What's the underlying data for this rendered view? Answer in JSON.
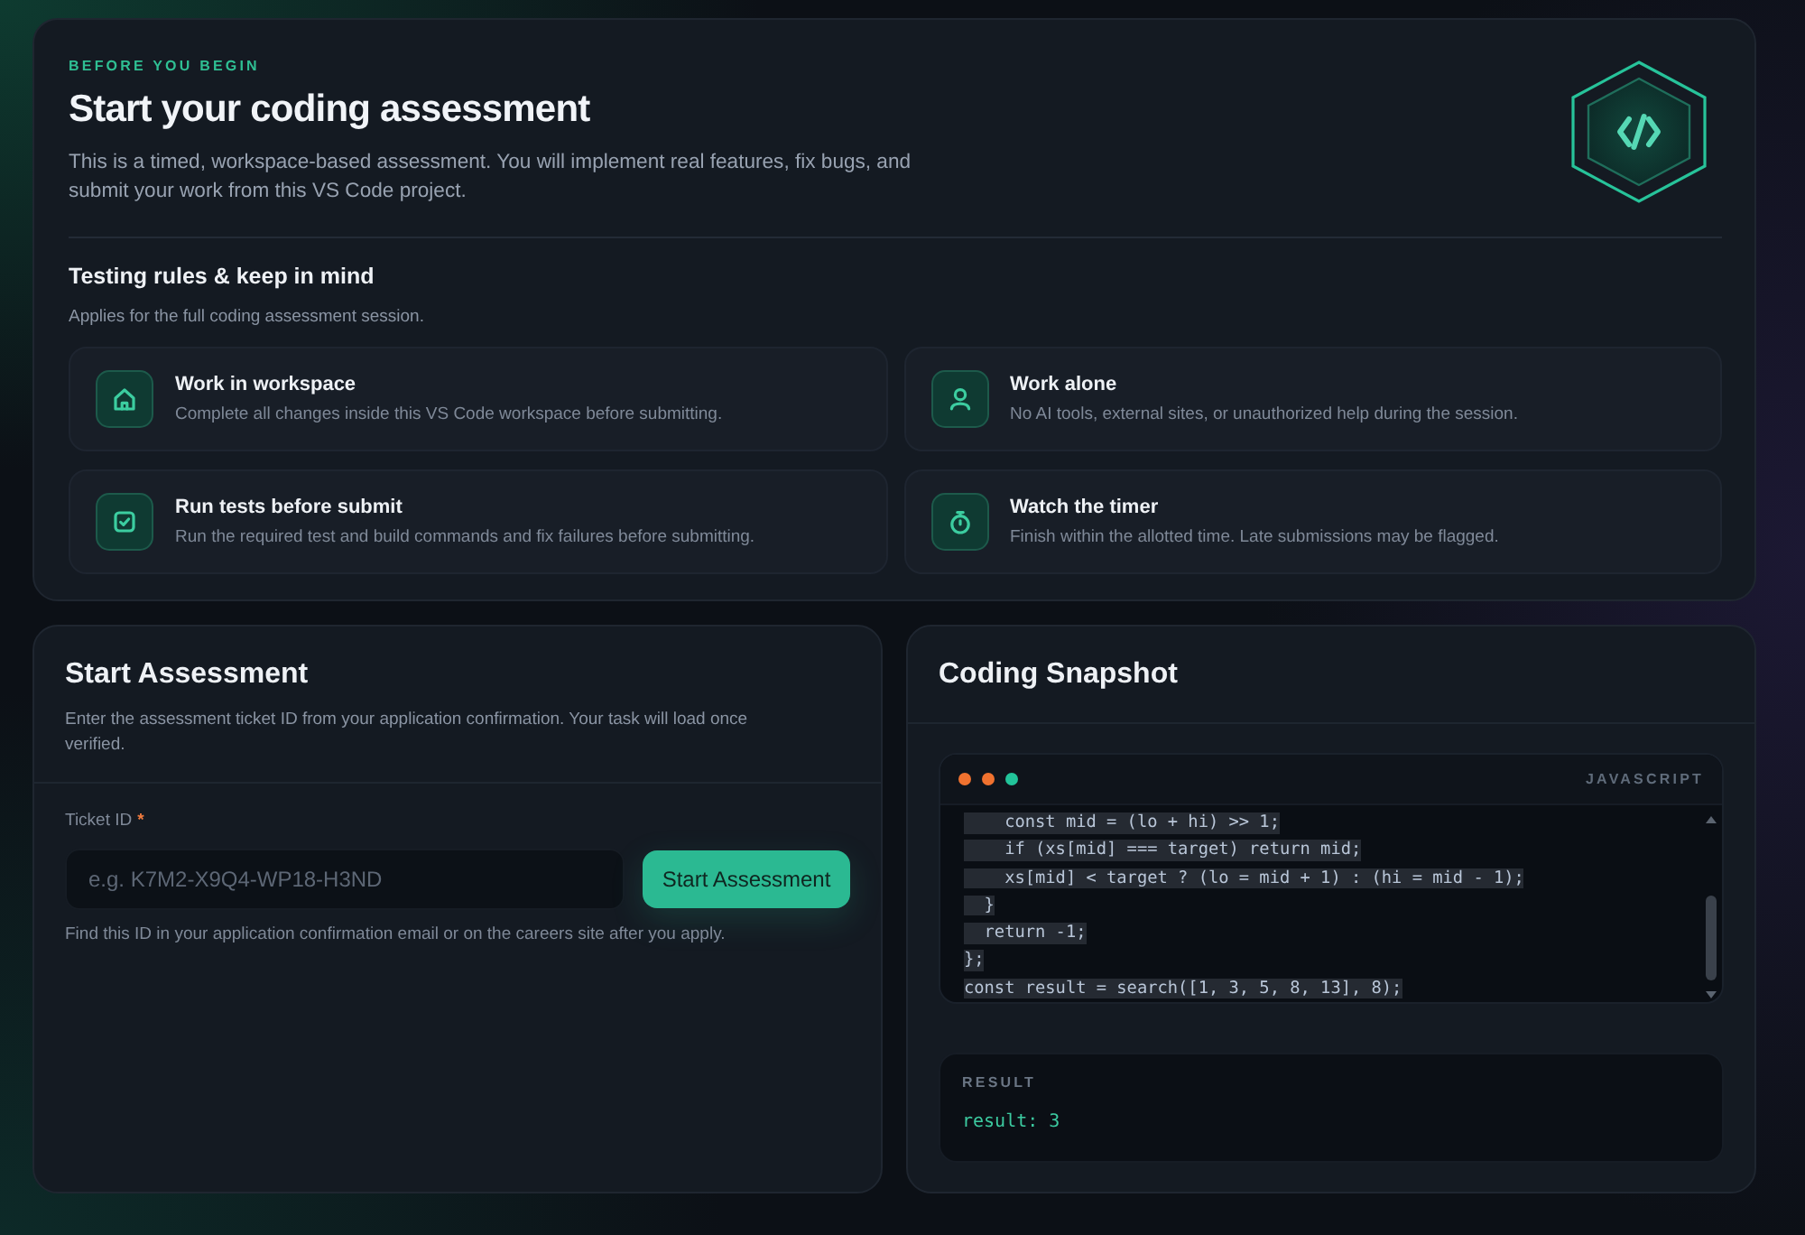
{
  "intro": {
    "eyebrow": "BEFORE YOU BEGIN",
    "title": "Start your coding assessment",
    "description": "This is a timed, workspace-based assessment. You will implement real features, fix bugs, and submit your work from this VS Code project."
  },
  "rules": {
    "title": "Testing rules & keep in mind",
    "subtitle": "Applies for the full coding assessment session.",
    "items": [
      {
        "title": "Work in workspace",
        "description": "Complete all changes inside this VS Code workspace before submitting."
      },
      {
        "title": "Work alone",
        "description": "No AI tools, external sites, or unauthorized help during the session."
      },
      {
        "title": "Run tests before submit",
        "description": "Run the required test and build commands and fix failures before submitting."
      },
      {
        "title": "Watch the timer",
        "description": "Finish within the allotted time. Late submissions may be flagged."
      }
    ]
  },
  "start_assessment": {
    "title": "Start Assessment",
    "description": "Enter the assessment ticket ID from your application confirmation. Your task will load once verified.",
    "ticket_field": {
      "label": "Ticket ID",
      "required_mark": "*",
      "placeholder": "e.g. K7M2-X9Q4-WP18-H3ND",
      "hint": "Find this ID in your application confirmation email or on the careers site after you apply."
    },
    "button": "Start Assessment"
  },
  "snapshot": {
    "title": "Coding Snapshot",
    "code": {
      "language": "JAVASCRIPT",
      "lines": [
        {
          "text": "    const mid = (lo + hi) >> 1;",
          "selected": true
        },
        {
          "text": "    if (xs[mid] === target) return mid;",
          "selected": true
        },
        {
          "text": "    xs[mid] < target ? (lo = mid + 1) : (hi = mid - 1);",
          "selected": true
        },
        {
          "text": "  }",
          "selected": true
        },
        {
          "text": "  return -1;",
          "selected": true
        },
        {
          "text": "};",
          "selected": true
        },
        {
          "text": "const result = search([1, 3, 5, 8, 13], 8);",
          "selected": true
        }
      ]
    },
    "result": {
      "label": "RESULT",
      "output": "result: 3"
    }
  }
}
